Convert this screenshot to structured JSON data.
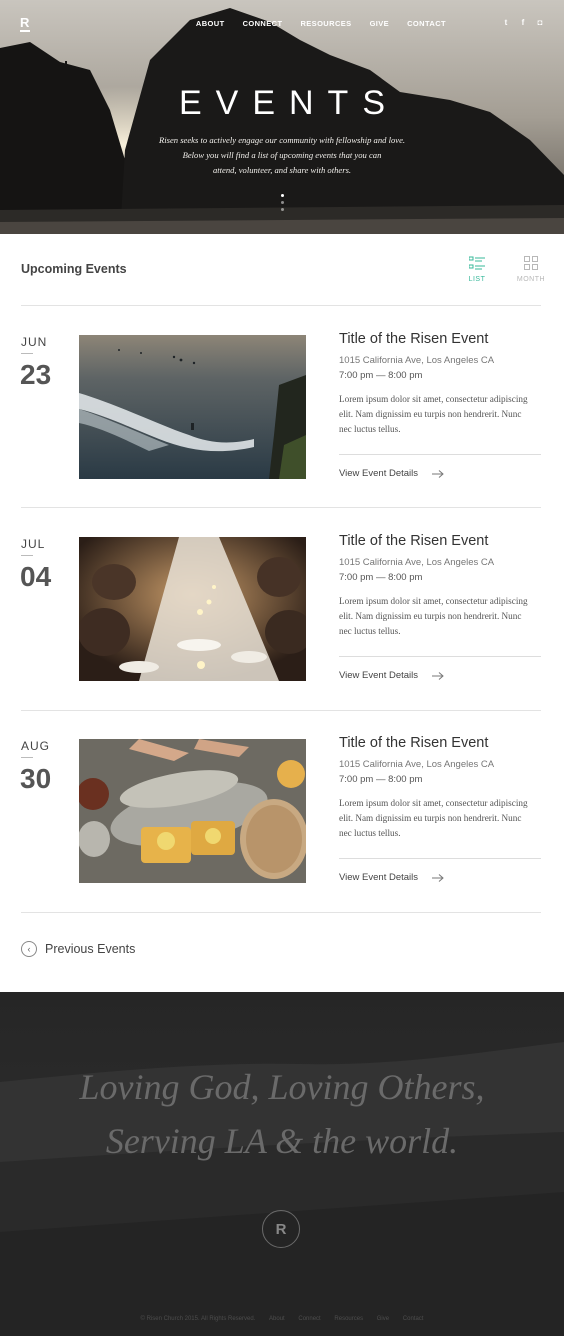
{
  "brand": {
    "logo": "R"
  },
  "nav": {
    "items": [
      "ABOUT",
      "CONNECT",
      "RESOURCES",
      "GIVE",
      "CONTACT"
    ],
    "social": [
      {
        "icon": "twitter-icon",
        "glyph": "t"
      },
      {
        "icon": "facebook-icon",
        "glyph": "f"
      },
      {
        "icon": "instagram-icon",
        "glyph": "◘"
      }
    ]
  },
  "hero": {
    "title": "EVENTS",
    "subtitle_lines": [
      "Risen seeks to actively engage our community with fellowship and love.",
      "Below you will find a list of upcoming events that you can",
      "attend, volunteer, and share with others."
    ]
  },
  "listing": {
    "heading": "Upcoming Events",
    "views": [
      {
        "label": "LIST",
        "icon": "list-view-icon",
        "active": true
      },
      {
        "label": "MONTH",
        "icon": "grid-view-icon",
        "active": false
      }
    ]
  },
  "events": [
    {
      "month": "JUN",
      "day": "23",
      "image": "surfers-ocean-photo",
      "title": "Title of the Risen Event",
      "address": "1015 California Ave, Los Angeles CA",
      "time": "7:00 pm — 8:00 pm",
      "description": "Lorem ipsum dolor sit amet, consectetur adipiscing elit. Nam dignissim eu turpis non hendrerit. Nunc nec luctus tellus.",
      "link": "View Event Details"
    },
    {
      "month": "JUL",
      "day": "04",
      "image": "candlelit-dinner-photo",
      "title": "Title of the Risen Event",
      "address": "1015 California Ave, Los Angeles CA",
      "time": "7:00 pm — 8:00 pm",
      "description": "Lorem ipsum dolor sit amet, consectetur adipiscing elit. Nam dignissim eu turpis non hendrerit. Nunc nec luctus tellus.",
      "link": "View Event Details"
    },
    {
      "month": "AUG",
      "day": "30",
      "image": "fish-and-bread-photo",
      "title": "Title of the Risen Event",
      "address": "1015 California Ave, Los Angeles CA",
      "time": "7:00 pm — 8:00 pm",
      "description": "Lorem ipsum dolor sit amet, consectetur adipiscing elit. Nam dignissim eu turpis non hendrerit. Nunc nec luctus tellus.",
      "link": "View Event Details"
    }
  ],
  "pagination": {
    "previous_label": "Previous Events"
  },
  "footer": {
    "tagline_lines": [
      "Loving God, Loving Others,",
      "Serving LA & the world."
    ],
    "logo": "R",
    "bottom_items": [
      "© Risen Church 2015. All Rights Reserved.",
      "About",
      "Connect",
      "Resources",
      "Give",
      "Contact"
    ]
  }
}
